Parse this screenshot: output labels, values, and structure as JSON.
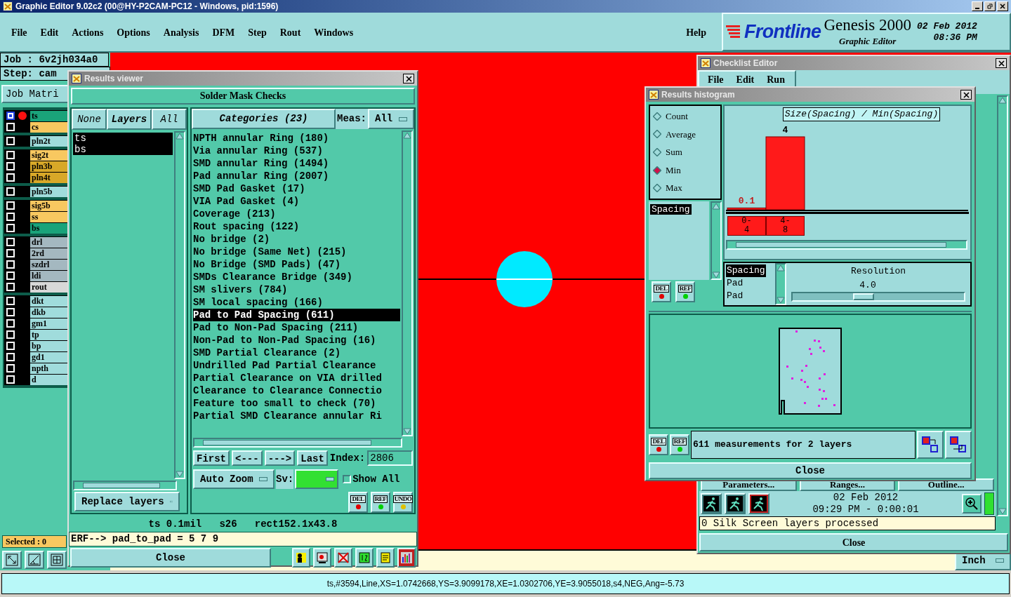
{
  "window": {
    "title": "Graphic Editor 9.02c2 (00@HY-P2CAM-PC12 - Windows, pid:1596)"
  },
  "menu": [
    "File",
    "Edit",
    "Actions",
    "Options",
    "Analysis",
    "DFM",
    "Step",
    "Rout",
    "Windows"
  ],
  "help": "Help",
  "brand": {
    "logo": "Frontline",
    "product": "Genesis 2000",
    "subtitle": "Graphic Editor",
    "date": "02 Feb 2012",
    "time": "08:36 PM"
  },
  "job": {
    "job": "Job : 6v2jh034a0",
    "step": "Step: cam",
    "matrix_button": "Job Matri"
  },
  "layer_groups": [
    [
      {
        "name": "ts",
        "color": "#1aa37a",
        "selected": true,
        "work": true
      },
      {
        "name": "cs",
        "color": "#f8c860",
        "selected": false,
        "work": false
      }
    ],
    [
      {
        "name": "pln2t",
        "color": "#a0dcdc",
        "selected": false,
        "work": false
      }
    ],
    [
      {
        "name": "sig2t",
        "color": "#f8c860",
        "selected": false,
        "work": false
      },
      {
        "name": "pln3b",
        "color": "#d8a828",
        "selected": false,
        "work": false
      },
      {
        "name": "pln4t",
        "color": "#d8a828",
        "selected": false,
        "work": false
      }
    ],
    [
      {
        "name": "pln5b",
        "color": "#a0dcdc",
        "selected": false,
        "work": false
      }
    ],
    [
      {
        "name": "sig5b",
        "color": "#f8c860",
        "selected": false,
        "work": false
      },
      {
        "name": "ss",
        "color": "#f8c860",
        "selected": false,
        "work": false
      },
      {
        "name": "bs",
        "color": "#1aa37a",
        "selected": false,
        "work": false
      }
    ],
    [
      {
        "name": "drl",
        "color": "#a4b8c0",
        "selected": false,
        "work": false
      },
      {
        "name": "2rd",
        "color": "#a4b8c0",
        "selected": false,
        "work": false
      },
      {
        "name": "szdrl",
        "color": "#a4b8c0",
        "selected": false,
        "work": false
      },
      {
        "name": "ldi",
        "color": "#a4b8c0",
        "selected": false,
        "work": false
      },
      {
        "name": "rout",
        "color": "#d8d8d8",
        "selected": false,
        "work": false
      }
    ],
    [
      {
        "name": "dkt",
        "color": "#a0dcdc",
        "selected": false,
        "work": false
      },
      {
        "name": "dkb",
        "color": "#a0dcdc",
        "selected": false,
        "work": false
      },
      {
        "name": "gm1",
        "color": "#a0dcdc",
        "selected": false,
        "work": false
      },
      {
        "name": "tp",
        "color": "#a0dcdc",
        "selected": false,
        "work": false
      },
      {
        "name": "bp",
        "color": "#a0dcdc",
        "selected": false,
        "work": false
      },
      {
        "name": "gd1",
        "color": "#a0dcdc",
        "selected": false,
        "work": false
      },
      {
        "name": "npth",
        "color": "#a0dcdc",
        "selected": false,
        "work": false
      },
      {
        "name": "d",
        "color": "#a0dcdc",
        "selected": false,
        "work": false
      }
    ]
  ],
  "selected_count": "Selected : 0",
  "units": "Inch",
  "status_line": "ts,#3594,Line,XS=1.0742668,YS=3.9099178,XE=1.0302706,YE=3.9055018,s4,NEG,Ang=-5.73",
  "results_viewer": {
    "title": "Results viewer",
    "header": "Solder Mask Checks",
    "layer_buttons": [
      "None",
      "Layers",
      "All"
    ],
    "layers": [
      {
        "name": "ts",
        "selected": true
      },
      {
        "name": "bs",
        "selected": true
      }
    ],
    "layer_mode": "Replace layers",
    "categories_button": "Categories (23)",
    "meas_label": "Meas:",
    "meas_value": "All",
    "categories": [
      {
        "name": "NPTH annular Ring (180)",
        "selected": false
      },
      {
        "name": "Via annular Ring (537)",
        "selected": false
      },
      {
        "name": "SMD annular Ring (1494)",
        "selected": false
      },
      {
        "name": "Pad annular Ring (2007)",
        "selected": false
      },
      {
        "name": "SMD Pad Gasket (17)",
        "selected": false
      },
      {
        "name": "VIA Pad Gasket (4)",
        "selected": false
      },
      {
        "name": "Coverage (213)",
        "selected": false
      },
      {
        "name": "Rout spacing (122)",
        "selected": false
      },
      {
        "name": "No bridge (2)",
        "selected": false
      },
      {
        "name": "No bridge (Same Net) (215)",
        "selected": false
      },
      {
        "name": "No Bridge (SMD Pads) (47)",
        "selected": false
      },
      {
        "name": "SMDs Clearance Bridge (349)",
        "selected": false
      },
      {
        "name": "SM slivers (784)",
        "selected": false
      },
      {
        "name": "SM local spacing (166)",
        "selected": false
      },
      {
        "name": "Pad to Pad Spacing (611)",
        "selected": true
      },
      {
        "name": "Pad to Non-Pad Spacing (211)",
        "selected": false
      },
      {
        "name": "Non-Pad to Non-Pad Spacing (16)",
        "selected": false
      },
      {
        "name": "SMD Partial Clearance (2)",
        "selected": false
      },
      {
        "name": "Undrilled Pad Partial Clearance",
        "selected": false
      },
      {
        "name": "Partial Clearance on VIA drilled",
        "selected": false
      },
      {
        "name": "Clearance to Clearance Connectio",
        "selected": false
      },
      {
        "name": "Feature too small to check (70)",
        "selected": false
      },
      {
        "name": "Partial SMD Clearance annular Ri",
        "selected": false
      }
    ],
    "nav": [
      "First",
      "<---",
      "--->",
      "Last"
    ],
    "index_label": "Index:",
    "index_value": "2806",
    "zoom_mode": "Auto Zoom",
    "sv_label": "Sv:",
    "show_all": {
      "label": "Show All",
      "checked": false
    },
    "actions": [
      "DEL",
      "REF",
      "UNDO"
    ],
    "info": "ts 0.1mil   s26   rect152.1x43.8",
    "erf": "ERF--> pad_to_pad = 5 7 9",
    "close": "Close"
  },
  "histogram": {
    "title": "Results histogram",
    "modes": [
      {
        "label": "Count",
        "selected": false
      },
      {
        "label": "Average",
        "selected": false
      },
      {
        "label": "Sum",
        "selected": false
      },
      {
        "label": "Min",
        "selected": true
      },
      {
        "label": "Max",
        "selected": false
      }
    ],
    "attributes": [
      {
        "name": "Spacing",
        "selected": true
      }
    ],
    "chart_data": {
      "type": "bar",
      "title": "Size(Spacing) / Min(Spacing)",
      "categories": [
        "0-4",
        "4-8"
      ],
      "values": [
        0.1,
        4
      ],
      "data_labels": true
    },
    "fields": [
      {
        "name": "Spacing",
        "selected": true
      },
      {
        "name": "Pad",
        "selected": false
      },
      {
        "name": "Pad",
        "selected": false
      }
    ],
    "resolution": {
      "label": "Resolution",
      "value": "4.0",
      "level": 0.4
    },
    "list_actions": [
      "DEL",
      "REF"
    ],
    "summary_actions": [
      "DEL",
      "REF"
    ],
    "summary": "611 measurements for 2 layers",
    "close": "Close"
  },
  "checklist": {
    "title": "Checklist Editor",
    "menu": [
      "File",
      "Edit",
      "Run"
    ],
    "buttons": [
      "Parameters...",
      "Ranges...",
      "Outline..."
    ],
    "date": "02 Feb 2012",
    "elapsed": "09:29 PM - 0:00:01",
    "message": "0 Silk Screen layers processed",
    "close": "Close"
  }
}
